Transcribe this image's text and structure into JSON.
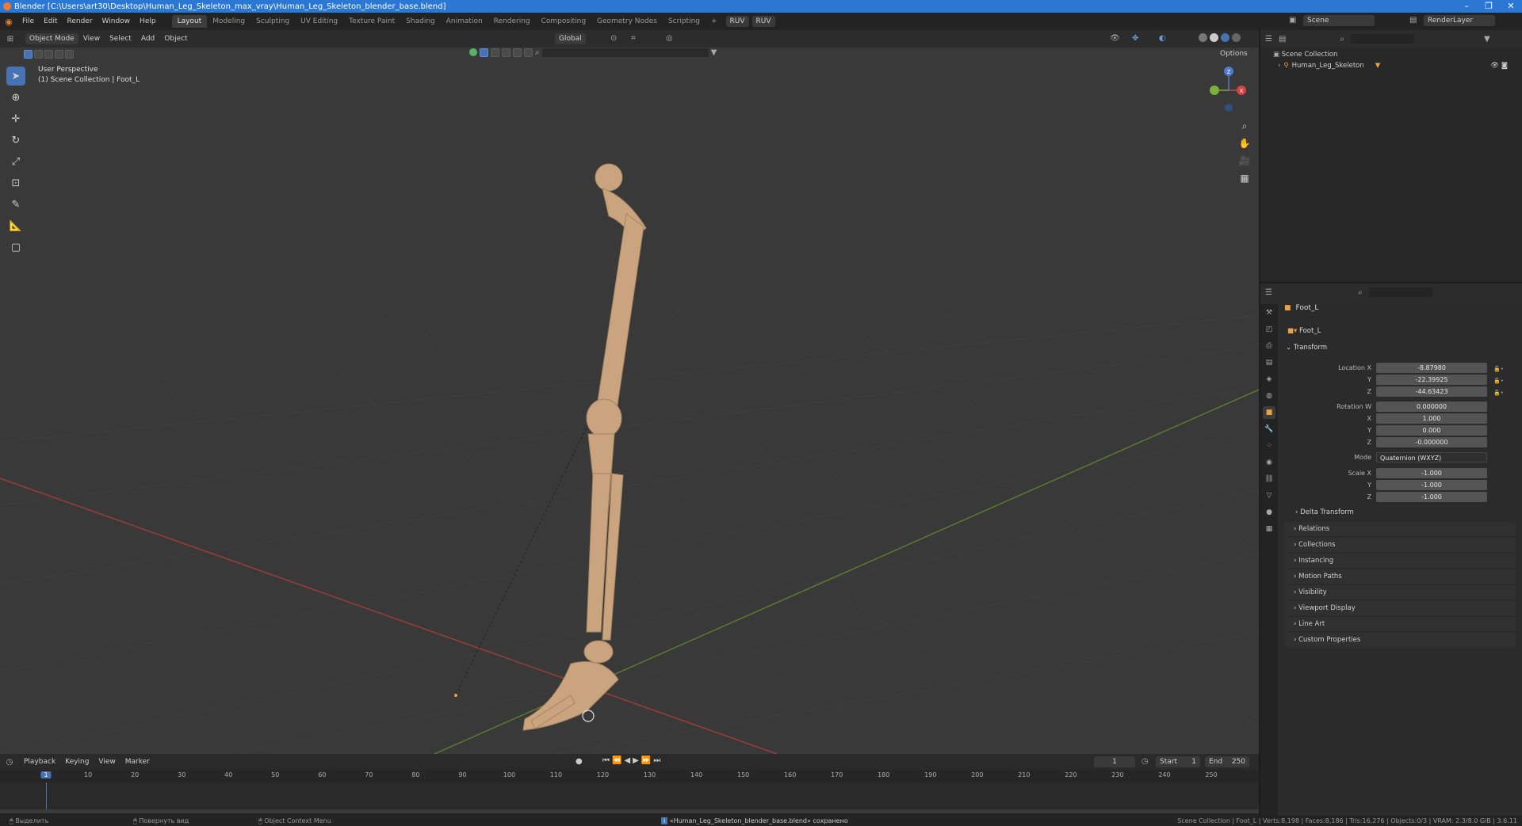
{
  "titlebar": {
    "title": "Blender [C:\\Users\\art30\\Desktop\\Human_Leg_Skeleton_max_vray\\Human_Leg_Skeleton_blender_base.blend]",
    "minimize": "–",
    "maximize": "❐",
    "close": "✕"
  },
  "menus": [
    "File",
    "Edit",
    "Render",
    "Window",
    "Help"
  ],
  "workspaces": [
    "Layout",
    "Modeling",
    "Sculpting",
    "UV Editing",
    "Texture Paint",
    "Shading",
    "Animation",
    "Rendering",
    "Compositing",
    "Geometry Nodes",
    "Scripting"
  ],
  "ruv_buttons": [
    "RUV",
    "RUV"
  ],
  "scene": {
    "label": "Scene",
    "render_layer": "RenderLayer"
  },
  "viewport_header": {
    "mode": "Object Mode",
    "menus": [
      "View",
      "Select",
      "Add",
      "Object"
    ],
    "orientation": "Global",
    "options": "Options"
  },
  "viewport_overlay": {
    "perspective": "User Perspective",
    "collection": "(1) Scene Collection | Foot_L"
  },
  "gizmo": {
    "x": "X",
    "y": "Y",
    "z": "Z"
  },
  "outliner": {
    "root": "Scene Collection",
    "items": [
      {
        "label": "Human_Leg_Skeleton"
      }
    ]
  },
  "properties": {
    "object_name": "Foot_L",
    "object_name_field": "Foot_L",
    "transform_label": "Transform",
    "location": {
      "label": "Location X",
      "x": "-8.87980",
      "y": "-22.39925",
      "z": "-44.63423"
    },
    "rotation": {
      "label": "Rotation W",
      "w": "0.000000",
      "x": "1.000",
      "y": "0.000",
      "z": "-0.000000"
    },
    "mode": {
      "label": "Mode",
      "value": "Quaternion (WXYZ)"
    },
    "scale": {
      "label": "Scale X",
      "x": "-1.000",
      "y": "-1.000",
      "z": "-1.000"
    },
    "axis_y": "Y",
    "axis_z": "Z",
    "axis_x": "X",
    "delta_transform": "Delta Transform",
    "panels": [
      "Relations",
      "Collections",
      "Instancing",
      "Motion Paths",
      "Visibility",
      "Viewport Display",
      "Line Art",
      "Custom Properties"
    ]
  },
  "timeline": {
    "menus": [
      "Playback",
      "Keying",
      "View",
      "Marker"
    ],
    "current_frame": "1",
    "start_label": "Start",
    "start": "1",
    "end_label": "End",
    "end": "250",
    "ticks": [
      "1",
      "10",
      "20",
      "30",
      "40",
      "50",
      "60",
      "70",
      "80",
      "90",
      "100",
      "110",
      "120",
      "130",
      "140",
      "150",
      "160",
      "170",
      "180",
      "190",
      "200",
      "210",
      "220",
      "230",
      "240",
      "250"
    ]
  },
  "statusbar": {
    "left1": "Выделить",
    "left2": "Повернуть вид",
    "left3": "Object Context Menu",
    "message": "«Human_Leg_Skeleton_blender_base.blend» сохранено",
    "right": "Scene Collection | Foot_L | Verts:8,198 | Faces:8,186 | Tris:16,276 | Objects:0/3 | VRAM: 2.3/8.0 GiB | 3.6.11"
  },
  "colors": {
    "accent": "#4772b3",
    "bone": "#c9a47e",
    "x_axis": "#b3413f",
    "y_axis": "#7ea13b",
    "titlebar": "#2b78d4"
  }
}
